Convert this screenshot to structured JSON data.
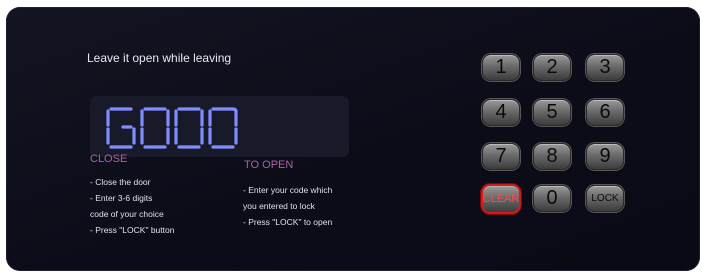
{
  "status_text": "Leave it open while leaving",
  "display": {
    "text": "GOOD",
    "color": "#7f8dff"
  },
  "close_section": {
    "title": "CLOSE",
    "steps": [
      "- Close the door",
      "- Enter 3-6 digits",
      "code of your choice",
      "- Press \"LOCK\" button"
    ]
  },
  "open_section": {
    "title": "TO OPEN",
    "steps": [
      "- Enter your code which",
      "you entered to lock",
      "- Press \"LOCK\" to open"
    ]
  },
  "keypad": {
    "keys": [
      "1",
      "2",
      "3",
      "4",
      "5",
      "6",
      "7",
      "8",
      "9",
      "CLEAR",
      "0",
      "LOCK"
    ]
  },
  "colors": {
    "panel": "#0d0e1a",
    "section_title": "#b25fa8",
    "clear_border": "#d21a1a"
  }
}
